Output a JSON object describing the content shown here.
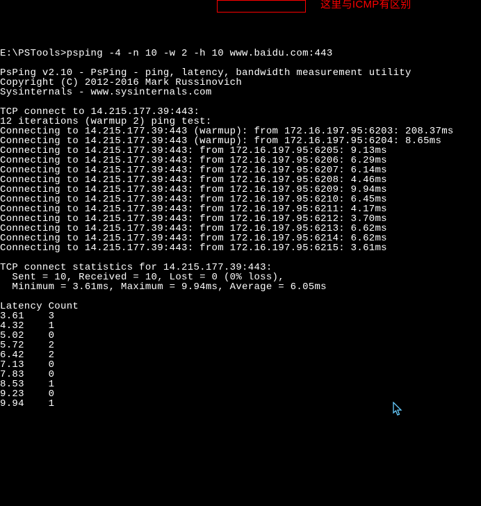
{
  "prompt": "E:\\PSTools>",
  "command": "psping -4 -n 10 -w 2 -h 10 www.baidu.com:443",
  "annotation": "这里与ICMP有区别",
  "header": {
    "title": "PsPing v2.10 - PsPing - ping, latency, bandwidth measurement utility",
    "copyright": "Copyright (C) 2012-2016 Mark Russinovich",
    "site": "Sysinternals - www.sysinternals.com"
  },
  "connect_header": "TCP connect to 14.215.177.39:443:",
  "iterations": "12 iterations (warmup 2) ping test:",
  "pings": [
    "Connecting to 14.215.177.39:443 (warmup): from 172.16.197.95:6203: 208.37ms",
    "Connecting to 14.215.177.39:443 (warmup): from 172.16.197.95:6204: 8.65ms",
    "Connecting to 14.215.177.39:443: from 172.16.197.95:6205: 9.13ms",
    "Connecting to 14.215.177.39:443: from 172.16.197.95:6206: 6.29ms",
    "Connecting to 14.215.177.39:443: from 172.16.197.95:6207: 6.14ms",
    "Connecting to 14.215.177.39:443: from 172.16.197.95:6208: 4.46ms",
    "Connecting to 14.215.177.39:443: from 172.16.197.95:6209: 9.94ms",
    "Connecting to 14.215.177.39:443: from 172.16.197.95:6210: 6.45ms",
    "Connecting to 14.215.177.39:443: from 172.16.197.95:6211: 4.17ms",
    "Connecting to 14.215.177.39:443: from 172.16.197.95:6212: 3.70ms",
    "Connecting to 14.215.177.39:443: from 172.16.197.95:6213: 6.62ms",
    "Connecting to 14.215.177.39:443: from 172.16.197.95:6214: 6.62ms",
    "Connecting to 14.215.177.39:443: from 172.16.197.95:6215: 3.61ms"
  ],
  "stats_header": "TCP connect statistics for 14.215.177.39:443:",
  "stats_line1": "  Sent = 10, Received = 10, Lost = 0 (0% loss),",
  "stats_line2": "  Minimum = 3.61ms, Maximum = 9.94ms, Average = 6.05ms",
  "hist_header": "Latency Count",
  "histogram": [
    {
      "lat": "3.61",
      "count": "3"
    },
    {
      "lat": "4.32",
      "count": "1"
    },
    {
      "lat": "5.02",
      "count": "0"
    },
    {
      "lat": "5.72",
      "count": "2"
    },
    {
      "lat": "6.42",
      "count": "2"
    },
    {
      "lat": "7.13",
      "count": "0"
    },
    {
      "lat": "7.83",
      "count": "0"
    },
    {
      "lat": "8.53",
      "count": "1"
    },
    {
      "lat": "9.23",
      "count": "0"
    },
    {
      "lat": "9.94",
      "count": "1"
    }
  ],
  "chart_data": {
    "type": "table",
    "title": "Latency Count",
    "columns": [
      "Latency",
      "Count"
    ],
    "rows": [
      [
        "3.61",
        3
      ],
      [
        "4.32",
        1
      ],
      [
        "5.02",
        0
      ],
      [
        "5.72",
        2
      ],
      [
        "6.42",
        2
      ],
      [
        "7.13",
        0
      ],
      [
        "7.83",
        0
      ],
      [
        "8.53",
        1
      ],
      [
        "9.23",
        0
      ],
      [
        "9.94",
        1
      ]
    ]
  }
}
